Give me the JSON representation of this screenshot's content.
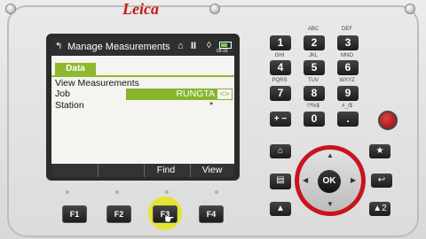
{
  "brand": "Leica",
  "screen": {
    "title": "Manage Measurements",
    "time": "09:33",
    "tab": "Data",
    "rows": [
      {
        "label": "View Measurements"
      },
      {
        "label": "Job",
        "value": "RUNGTA"
      },
      {
        "label": "Station",
        "value": "*"
      }
    ],
    "softkeys": [
      "",
      "",
      "Find",
      "View"
    ]
  },
  "fkeys": [
    "F1",
    "F2",
    "F3",
    "F4"
  ],
  "keypad": [
    {
      "digit": "1",
      "letters": ""
    },
    {
      "digit": "2",
      "letters": "ABC"
    },
    {
      "digit": "3",
      "letters": "DEF"
    },
    {
      "digit": "4",
      "letters": "GHI"
    },
    {
      "digit": "5",
      "letters": "JKL"
    },
    {
      "digit": "6",
      "letters": "MNO"
    },
    {
      "digit": "7",
      "letters": "PQRS"
    },
    {
      "digit": "8",
      "letters": "TUV"
    },
    {
      "digit": "9",
      "letters": "WXYZ"
    },
    {
      "digit": "+ −",
      "letters": ""
    },
    {
      "digit": "0",
      "letters": "!?%$"
    },
    {
      "digit": ".",
      "letters": "#_/$"
    }
  ],
  "nav": {
    "ok": "OK",
    "user2": "2"
  }
}
